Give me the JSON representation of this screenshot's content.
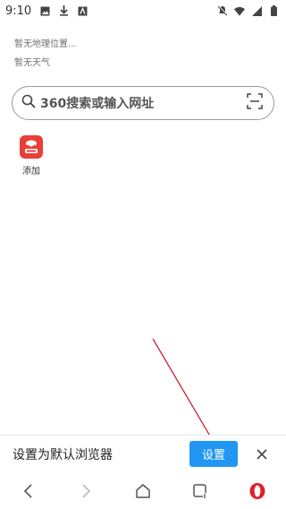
{
  "status": {
    "time": "9:10"
  },
  "home": {
    "location": "暂无地理位置...",
    "weather": "暂无天气",
    "search_placeholder": "360搜索或输入网址"
  },
  "shortcuts": [
    {
      "label": "添加"
    }
  ],
  "default_browser_bar": {
    "text": "设置为默认浏览器",
    "button": "设置"
  },
  "colors": {
    "accent": "#2196f3",
    "shortcut_red": "#e93f36",
    "opera_red": "#e0202c",
    "annotation": "#c8102e"
  },
  "icons": [
    "download-icon",
    "image-icon",
    "mute-icon",
    "wifi-icon",
    "signal-icon",
    "battery-icon",
    "search-icon",
    "scan-icon",
    "close-icon",
    "back-icon",
    "forward-icon",
    "home-icon",
    "tabs-icon",
    "opera-icon"
  ]
}
